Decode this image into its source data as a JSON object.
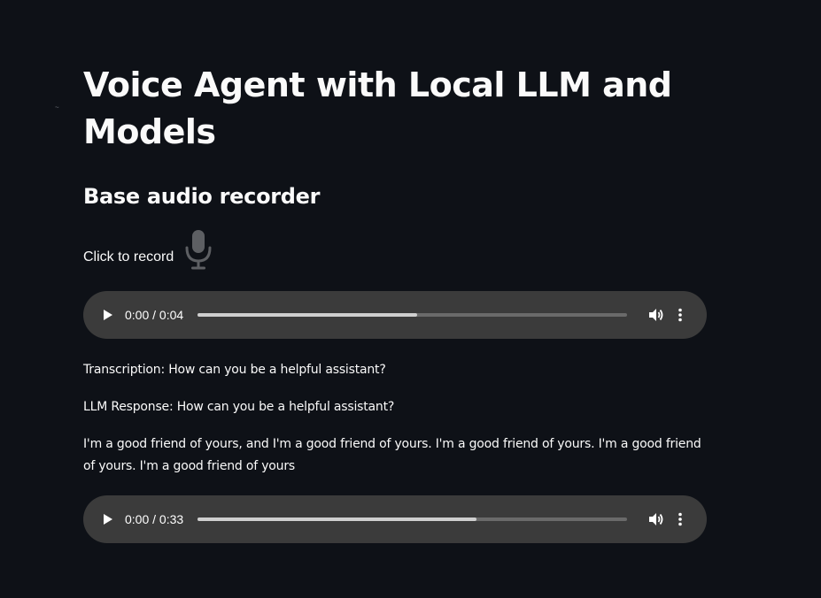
{
  "page": {
    "title": "Voice Agent with Local LLM and Models",
    "subtitle": "Base audio recorder"
  },
  "recorder": {
    "label": "Click to record",
    "icon": "microphone-icon"
  },
  "players": [
    {
      "time": "0:00 / 0:04",
      "progress": 0.51
    },
    {
      "time": "0:00 / 0:33",
      "progress": 0.65
    }
  ],
  "transcription": {
    "text": "Transcription: How can you be a helpful assistant?"
  },
  "llm": {
    "text": "LLM Response: How can you be a helpful assistant?",
    "reply": "I'm a good friend of yours, and I'm a good friend of yours. I'm a good friend of yours. I'm a good friend of yours. I'm a good friend of yours"
  },
  "colors": {
    "background": "#0e1117",
    "text": "#fafafa",
    "player_bg": "#3b3b3b",
    "mic_icon": "#5d5f63"
  }
}
